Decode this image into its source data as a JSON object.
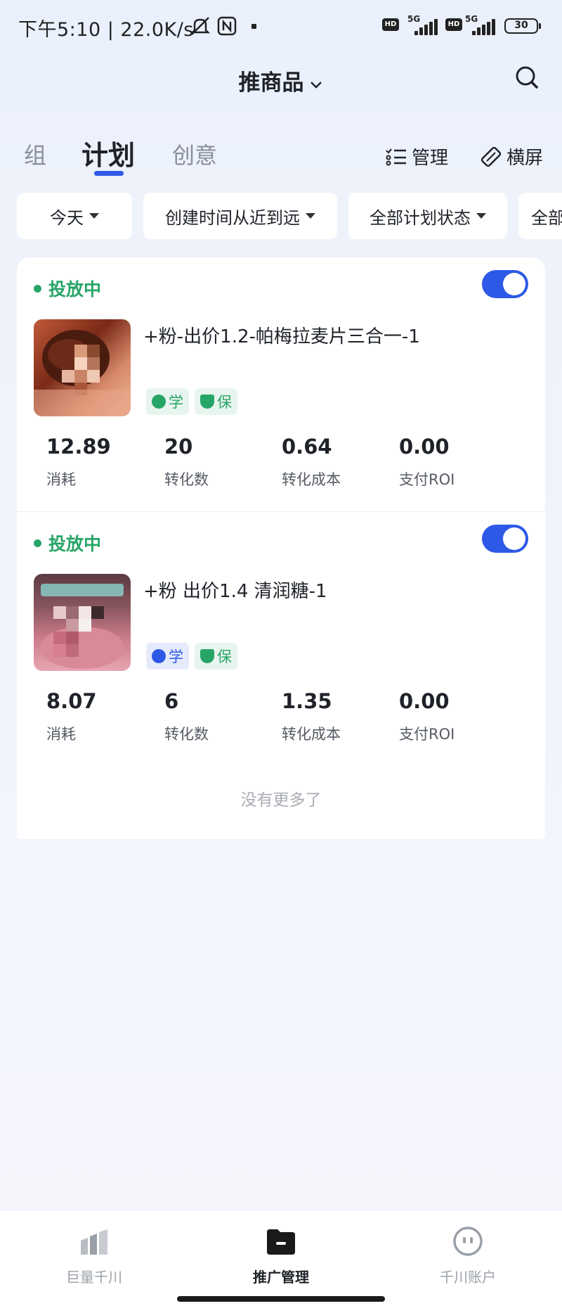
{
  "status_bar": {
    "time": "下午5:10 | 22.0K/s",
    "hd1": "HD",
    "net1": "5G",
    "hd2": "HD",
    "net2": "5G",
    "battery": "30"
  },
  "header": {
    "title": "推商品"
  },
  "tabs": [
    {
      "label": "组"
    },
    {
      "label": "计划"
    },
    {
      "label": "创意"
    }
  ],
  "actions": {
    "manage": "管理",
    "landscape": "横屏"
  },
  "filters": [
    {
      "label": "今天"
    },
    {
      "label": "创建时间从近到远"
    },
    {
      "label": "全部计划状态"
    },
    {
      "label": "全部"
    }
  ],
  "plans": [
    {
      "status": "投放中",
      "enabled": true,
      "name": "+粉-出价1.2-帕梅拉麦片三合一-1",
      "badges": [
        "学",
        "保"
      ],
      "metrics": [
        {
          "value": "12.89",
          "label": "消耗"
        },
        {
          "value": "20",
          "label": "转化数"
        },
        {
          "value": "0.64",
          "label": "转化成本"
        },
        {
          "value": "0.00",
          "label": "支付ROI"
        }
      ]
    },
    {
      "status": "投放中",
      "enabled": true,
      "name": "+粉 出价1.4 清润糖-1",
      "badges": [
        "学",
        "保"
      ],
      "metrics": [
        {
          "value": "8.07",
          "label": "消耗"
        },
        {
          "value": "6",
          "label": "转化数"
        },
        {
          "value": "1.35",
          "label": "转化成本"
        },
        {
          "value": "0.00",
          "label": "支付ROI"
        }
      ]
    }
  ],
  "list_end_text": "没有更多了",
  "bottom_nav": [
    {
      "label": "巨量千川",
      "icon": "chart-bars-icon"
    },
    {
      "label": "推广管理",
      "icon": "folder-icon"
    },
    {
      "label": "千川账户",
      "icon": "face-icon"
    }
  ],
  "colors": {
    "accent": "#2d59e6",
    "running": "#27a567"
  }
}
